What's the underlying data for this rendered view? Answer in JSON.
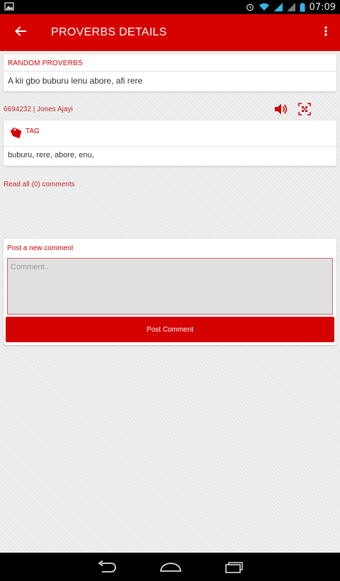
{
  "status_bar": {
    "time": "07:09"
  },
  "app_bar": {
    "title": "PROVERBS DETAILS"
  },
  "random_card": {
    "header": "RANDOM PROVERBS",
    "proverb": "A kii gbo buburu lenu abore, afi rere"
  },
  "meta": {
    "info": "6694232 | Jones Ajayi"
  },
  "tag_card": {
    "header": "TAG",
    "tags": "buburu, rere, abore, enu,"
  },
  "comments": {
    "read_all": "Read all (0) comments"
  },
  "comment_card": {
    "header": "Post a new comment",
    "placeholder": "Comment..",
    "button": "Post Comment"
  },
  "colors": {
    "primary": "#d50000",
    "link": "#c62828"
  }
}
